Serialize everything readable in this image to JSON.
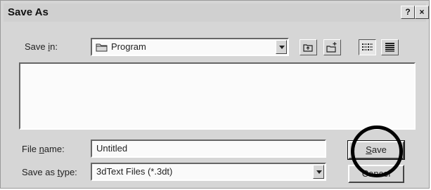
{
  "dialog": {
    "title": "Save As",
    "help_button": "?",
    "close_button": "×"
  },
  "save_in": {
    "label_prefix": "Save ",
    "label_accel": "i",
    "label_suffix": "n:",
    "value": "Program"
  },
  "toolbar": {
    "icons": [
      "up-one-level-icon",
      "create-new-folder-icon",
      "list-view-icon",
      "details-view-icon"
    ]
  },
  "file_name": {
    "label_prefix": "File ",
    "label_accel": "n",
    "label_suffix": "ame:",
    "value": "Untitled"
  },
  "save_as_type": {
    "label_prefix": "Save as ",
    "label_accel": "t",
    "label_suffix": "ype:",
    "value": "3dText Files (*.3dt)"
  },
  "buttons": {
    "save_accel": "S",
    "save_suffix": "ave",
    "cancel_label": "Cancel"
  },
  "colors": {
    "dialog_bg": "#d6d6d6",
    "field_bg": "#fafafa",
    "highlight_ring": "#000000"
  }
}
